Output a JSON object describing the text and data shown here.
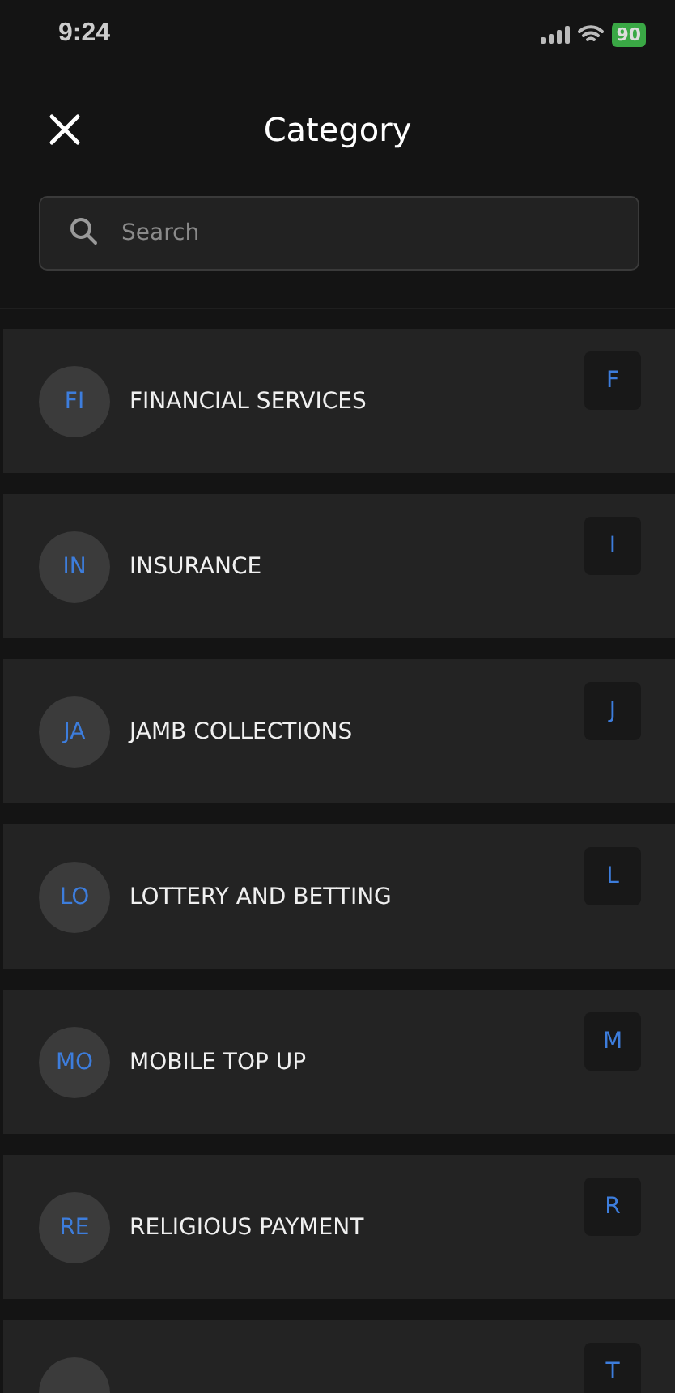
{
  "status_bar": {
    "time": "9:24",
    "battery": "90"
  },
  "header": {
    "title": "Category"
  },
  "search": {
    "placeholder": "Search"
  },
  "categories": [
    {
      "initials": "FI",
      "name": "FINANCIAL SERVICES",
      "index_letter": "F"
    },
    {
      "initials": "IN",
      "name": "INSURANCE",
      "index_letter": "I"
    },
    {
      "initials": "JA",
      "name": "JAMB COLLECTIONS",
      "index_letter": "J"
    },
    {
      "initials": "LO",
      "name": "LOTTERY AND BETTING",
      "index_letter": "L"
    },
    {
      "initials": "MO",
      "name": "MOBILE TOP UP",
      "index_letter": "M"
    },
    {
      "initials": "RE",
      "name": "RELIGIOUS PAYMENT",
      "index_letter": "R"
    },
    {
      "index_letter": "T"
    }
  ]
}
